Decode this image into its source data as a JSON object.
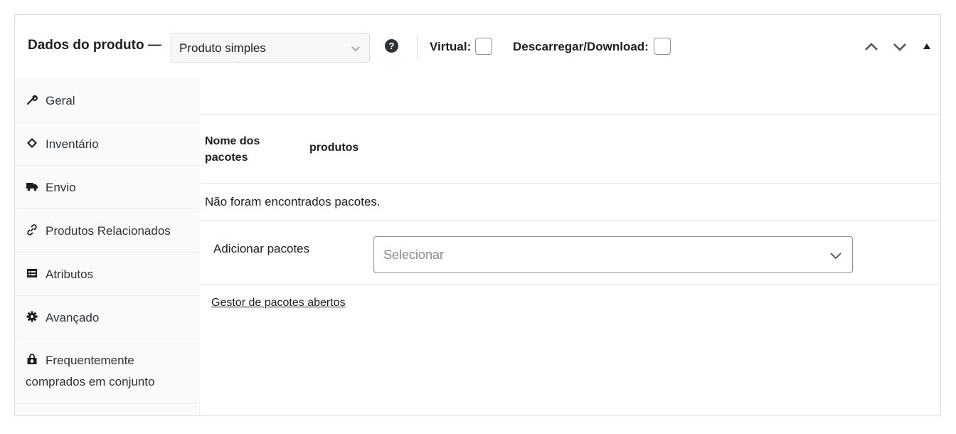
{
  "header": {
    "title": "Dados do produto —",
    "product_type": {
      "selected": "Produto simples",
      "icon": "chevron-down-icon"
    },
    "help_icon": "?",
    "virtual_label": "Virtual:",
    "virtual_checked": false,
    "download_label": "Descarregar/Download:",
    "download_checked": false,
    "controls": [
      "move-up-icon",
      "move-down-icon",
      "toggle-panel-icon"
    ]
  },
  "tabs": [
    {
      "label": "Geral",
      "icon": "wrench-icon"
    },
    {
      "label": "Inventário",
      "icon": "tag-icon"
    },
    {
      "label": "Envio",
      "icon": "truck-icon"
    },
    {
      "label": "Produtos Relacionados",
      "icon": "link-icon"
    },
    {
      "label": "Atributos",
      "icon": "list-icon"
    },
    {
      "label": "Avançado",
      "icon": "gear-icon"
    },
    {
      "label": "Frequentemente",
      "label2": "comprados em conjunto",
      "icon": "shopping-bag-icon"
    }
  ],
  "main": {
    "columns": [
      "Nome dos pacotes",
      "produtos"
    ],
    "empty_message": "Não foram encontrados pacotes.",
    "add_label": "Adicionar pacotes",
    "add_placeholder": "Selecionar",
    "manager_link": "Gestor de pacotes abertos"
  }
}
